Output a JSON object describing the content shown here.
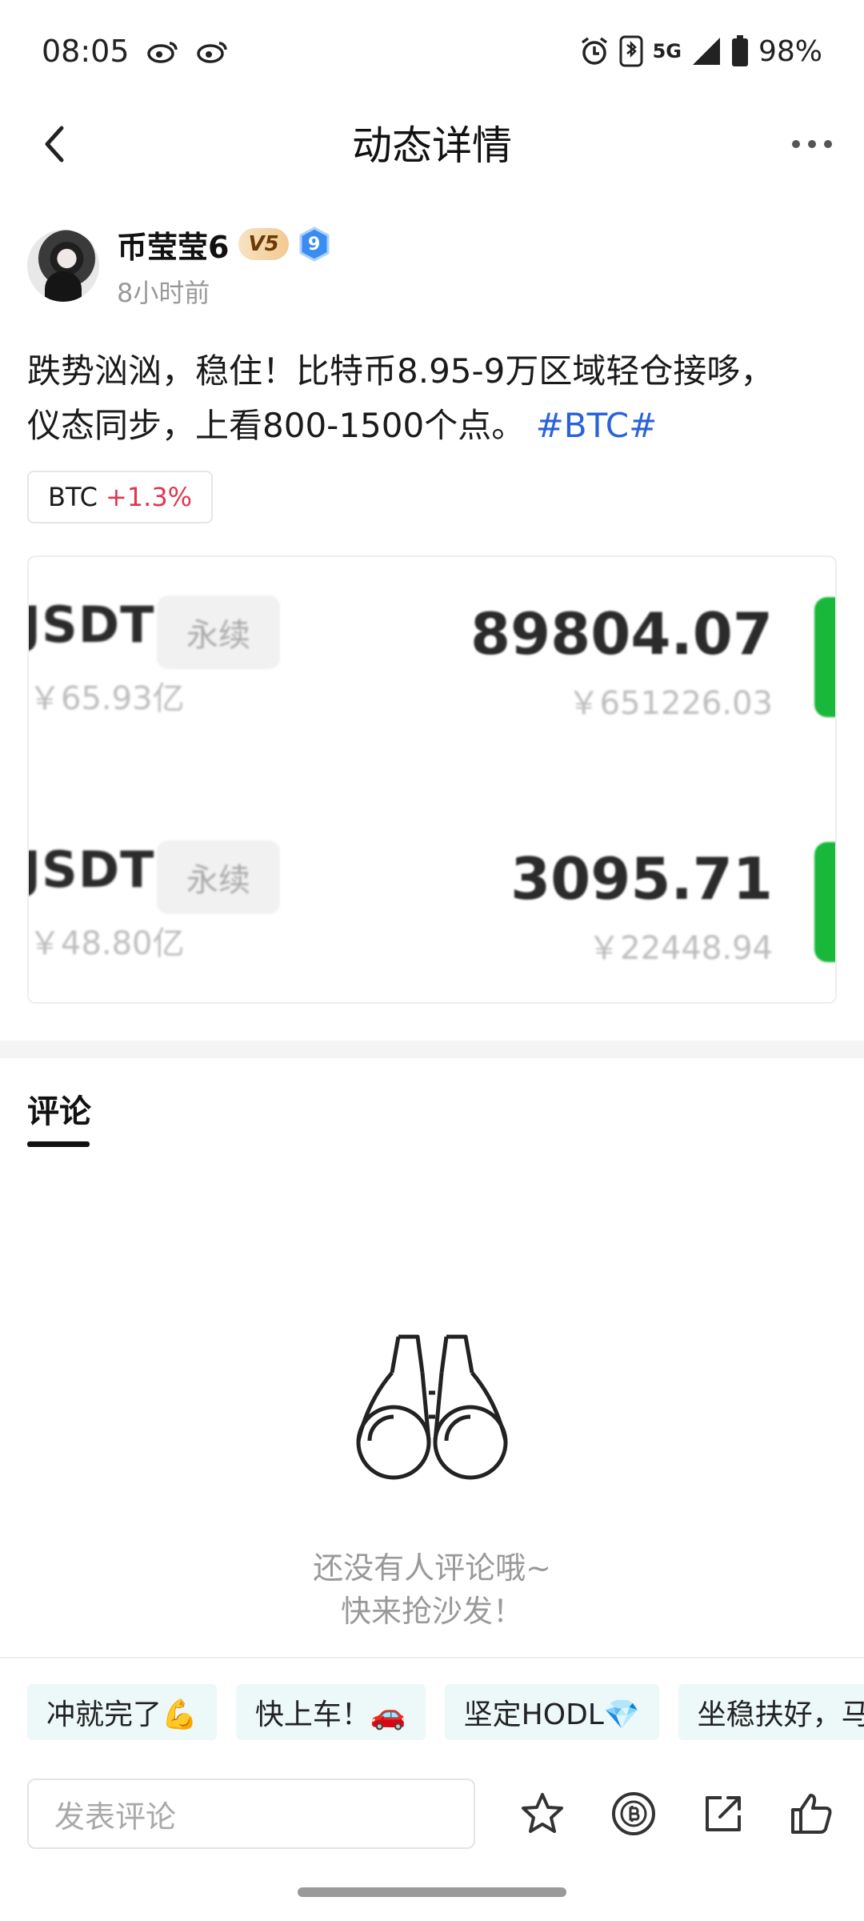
{
  "status_bar": {
    "time": "08:05",
    "battery": "98%",
    "network": "5G",
    "icons": [
      "weibo-icon",
      "weibo-icon",
      "alarm-icon",
      "bluetooth-icon",
      "signal-icon",
      "battery-icon"
    ]
  },
  "nav": {
    "title": "动态详情",
    "back_icon": "chevron-left-icon",
    "more_icon": "more-dots-icon"
  },
  "post": {
    "author": "币莹莹6",
    "vip_badge": "V5",
    "level_badge": "9",
    "time_ago": "8小时前",
    "text_line1": "跌势汹汹，稳住！比特币8.95-9万区域轻仓接哆，",
    "text_line2": "仪态同步，上看800-1500个点。",
    "hashtag": "#BTC#",
    "coin_chip": {
      "symbol": "BTC",
      "change": "+1.3%"
    },
    "image": {
      "rows": [
        {
          "pair": "JSDT",
          "tag": "永续",
          "volume": "￥65.93亿",
          "price": "89804.07",
          "price_cny": "￥651226.03"
        },
        {
          "pair": "JSDT",
          "tag": "永续",
          "volume": "￥48.80亿",
          "price": "3095.71",
          "price_cny": "￥22448.94"
        }
      ]
    }
  },
  "comments": {
    "tab_label": "评论",
    "empty_line1": "还没有人评论哦~",
    "empty_line2": "快来抢沙发！",
    "empty_icon": "binoculars-icon"
  },
  "quick_replies": [
    "冲就完了💪",
    "快上车！🚗",
    "坚定HODL💎",
    "坐稳扶好，马"
  ],
  "bottom_bar": {
    "input_placeholder": "发表评论",
    "actions": [
      "star-icon",
      "coin-icon",
      "share-icon",
      "like-icon"
    ]
  },
  "colors": {
    "accent_blue": "#2a63d8",
    "change_red": "#e0364f",
    "green": "#19b83a"
  }
}
